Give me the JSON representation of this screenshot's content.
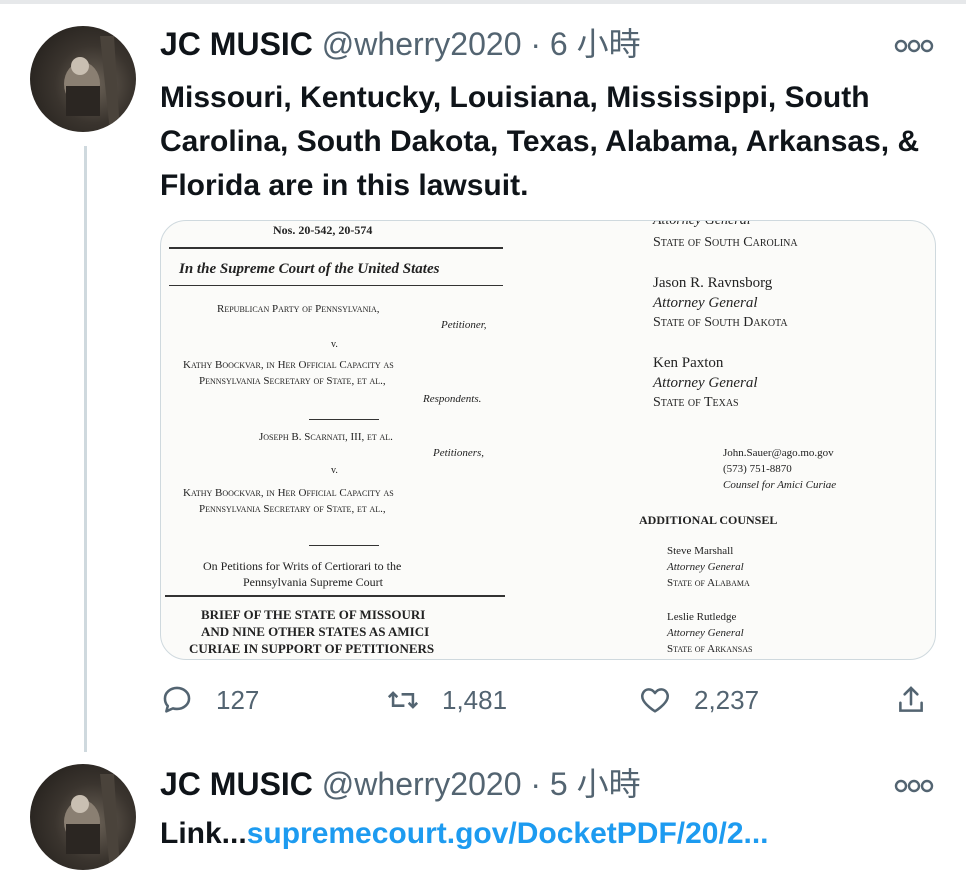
{
  "tweets": [
    {
      "name": "JC MUSIC",
      "handle": "@wherry2020",
      "dot": "·",
      "time": "6 小時",
      "text": "Missouri, Kentucky, Louisiana, Mississippi, South Carolina, South Dakota, Texas, Alabama, Arkansas, & Florida are in this lawsuit.",
      "media": {
        "left": {
          "docket": "Nos. 20-542, 20-574",
          "court": "In the Supreme Court of the United States",
          "party1": "Republican Party of Pennsylvania,",
          "role1": "Petitioner,",
          "v1": "v.",
          "resp1_line1": "Kathy Boockvar, in Her Official Capacity as",
          "resp1_line2": "Pennsylvania Secretary of State, et al.,",
          "role2": "Respondents.",
          "party2": "Joseph B. Scarnati, III, et al.",
          "role3": "Petitioners,",
          "v2": "v.",
          "resp2_line1": "Kathy Boockvar, in Her Official Capacity as",
          "resp2_line2": "Pennsylvania Secretary of State, et al.,",
          "petition_line1": "On Petitions for Writs of Certiorari to the",
          "petition_line2": "Pennsylvania Supreme Court",
          "brief_line1": "BRIEF OF THE STATE OF MISSOURI",
          "brief_line2": "AND NINE OTHER STATES AS AMICI",
          "brief_line3": "CURIAE IN SUPPORT OF PETITIONERS"
        },
        "right": {
          "ag_top": "Attorney General",
          "state_sc": "State of South Carolina",
          "name1": "Jason R. Ravnsborg",
          "ag1": "Attorney General",
          "state_sd": "State of South Dakota",
          "name2": "Ken Paxton",
          "ag2": "Attorney General",
          "state_tx": "State of Texas",
          "email": "John.Sauer@ago.mo.gov",
          "phone": "(573) 751-8870",
          "counsel": "Counsel for Amici Curiae",
          "additional": "ADDITIONAL COUNSEL",
          "name3": "Steve Marshall",
          "ag3": "Attorney General",
          "state_al": "State of Alabama",
          "name4": "Leslie Rutledge",
          "ag4": "Attorney General",
          "state_ar": "State of Arkansas"
        }
      },
      "actions": {
        "replies": "127",
        "retweets": "1,481",
        "likes": "2,237"
      }
    },
    {
      "name": "JC MUSIC",
      "handle": "@wherry2020",
      "dot": "·",
      "time": "5 小時",
      "text_prefix": "Link...",
      "link": "supremecourt.gov/DocketPDF/20/2..."
    }
  ],
  "icons": {
    "more": "more-horizontal-icon",
    "reply": "reply-bubble-icon",
    "retweet": "retweet-icon",
    "like": "heart-icon",
    "share": "share-upload-icon"
  },
  "colors": {
    "link": "#1d9bf0",
    "secondary": "#536471",
    "thread_line": "#cfd9de"
  }
}
